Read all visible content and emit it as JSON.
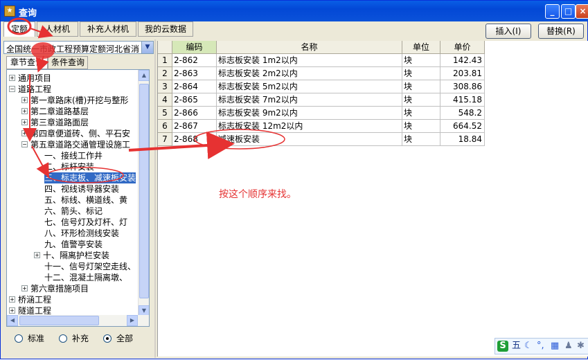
{
  "window": {
    "title": "查询",
    "controls": [
      "_",
      "□",
      "×"
    ]
  },
  "tabs": [
    {
      "label": "定额",
      "active": true
    },
    {
      "label": "人材机"
    },
    {
      "label": "补充人材机"
    },
    {
      "label": "我的云数据"
    }
  ],
  "actions": {
    "insert_label": "插入(I)",
    "replace_label": "替换(R)"
  },
  "library": {
    "selected": "全国统一市政工程预算定额河北省消"
  },
  "subtabs": {
    "chapter_label": "章节查询",
    "condition_label": "条件查询"
  },
  "tree": [
    {
      "label": "通用项目",
      "sign": "+"
    },
    {
      "label": "道路工程",
      "sign": "−"
    },
    {
      "label": "第一章路床(槽)开挖与整形",
      "sign": "+"
    },
    {
      "label": "第二章道路基层",
      "sign": "+"
    },
    {
      "label": "第三章道路面层",
      "sign": "+"
    },
    {
      "label": "第四章便道砖、侧、平石安",
      "sign": "+"
    },
    {
      "label": "第五章道路交通管理设施工",
      "sign": "−"
    },
    {
      "label": "一、接线工作井",
      "sign": ""
    },
    {
      "label": "二、标杆安装",
      "sign": ""
    },
    {
      "label": "三、标志板、减速板安装",
      "sign": "",
      "selected": true
    },
    {
      "label": "四、视线诱导器安装",
      "sign": ""
    },
    {
      "label": "五、标线、横道线、黄",
      "sign": ""
    },
    {
      "label": "六、箭头、标记",
      "sign": ""
    },
    {
      "label": "七、信号灯及灯杆、灯",
      "sign": ""
    },
    {
      "label": "八、环形检测线安装",
      "sign": ""
    },
    {
      "label": "九、值警亭安装",
      "sign": ""
    },
    {
      "label": "十、隔离护栏安装",
      "sign": "+"
    },
    {
      "label": "十一、信号灯架空走线、",
      "sign": ""
    },
    {
      "label": "十二、混凝土隔离墩、",
      "sign": ""
    },
    {
      "label": "第六章措施项目",
      "sign": "+"
    },
    {
      "label": "桥涵工程",
      "sign": "+"
    },
    {
      "label": "隧道工程",
      "sign": "+"
    }
  ],
  "filter": [
    {
      "label": "标准",
      "checked": false
    },
    {
      "label": "补充",
      "checked": false
    },
    {
      "label": "全部",
      "checked": true
    }
  ],
  "table": {
    "columns": [
      "编码",
      "名称",
      "单位",
      "单价"
    ],
    "rows": [
      {
        "n": "1",
        "code": "2-862",
        "name": "标志板安装 1m2以内",
        "unit": "块",
        "price": "142.43"
      },
      {
        "n": "2",
        "code": "2-863",
        "name": "标志板安装 2m2以内",
        "unit": "块",
        "price": "203.81"
      },
      {
        "n": "3",
        "code": "2-864",
        "name": "标志板安装 5m2以内",
        "unit": "块",
        "price": "308.86"
      },
      {
        "n": "4",
        "code": "2-865",
        "name": "标志板安装 7m2以内",
        "unit": "块",
        "price": "415.18"
      },
      {
        "n": "5",
        "code": "2-866",
        "name": "标志板安装 9m2以内",
        "unit": "块",
        "price": "548.2"
      },
      {
        "n": "6",
        "code": "2-867",
        "name": "标志板安装 12m2以内",
        "unit": "块",
        "price": "664.52"
      },
      {
        "n": "7",
        "code": "2-868",
        "name": "减速板安装",
        "unit": "块",
        "price": "18.84"
      }
    ]
  },
  "annotation": "按这个顺序来找。",
  "ime": {
    "logo": "S",
    "mode": "五",
    "icons": [
      "moon-icon",
      "punctuation-icon",
      "keyboard-icon",
      "user-icon",
      "menu-icon"
    ]
  },
  "colors": {
    "title_bar": "#0348d6",
    "selection": "#316ac5",
    "annotation_red": "#e53333",
    "code_header": "#d6e8b8"
  }
}
